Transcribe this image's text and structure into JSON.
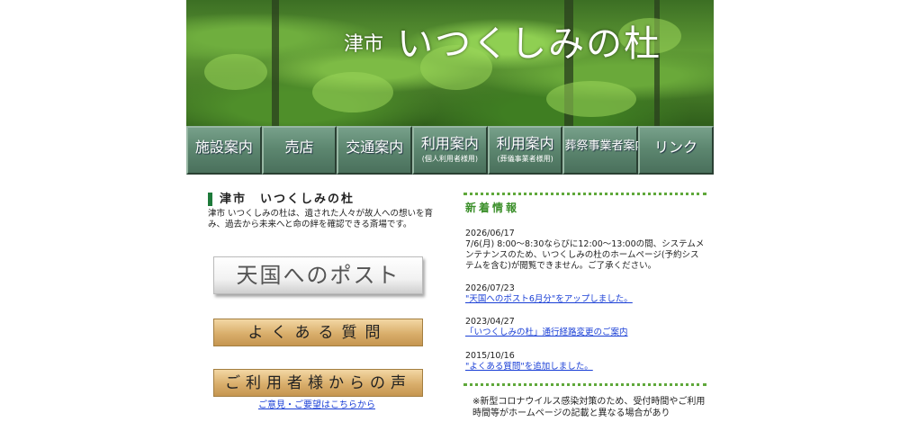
{
  "header": {
    "city": "津市",
    "title": "いつくしみの杜"
  },
  "nav": [
    {
      "label": "施設案内",
      "sub": ""
    },
    {
      "label": "売店",
      "sub": ""
    },
    {
      "label": "交通案内",
      "sub": ""
    },
    {
      "label": "利用案内",
      "sub": "(個人利用者様用)"
    },
    {
      "label": "利用案内",
      "sub": "(葬儀事業者様用)"
    },
    {
      "label": "葬祭事業者案内",
      "sub": ""
    },
    {
      "label": "リンク",
      "sub": ""
    }
  ],
  "intro": {
    "title": "津市　いつくしみの杜",
    "text": "津市 いつくしみの杜は、遺された人々が故人への想いを育み、過去から未来へと命の絆を確認できる斎場です。"
  },
  "buttons": {
    "post": "天国へのポスト",
    "faq": "よくある質問",
    "voice": "ご利用者様からの声",
    "voice_link": "ご意見・ご要望はこちらから"
  },
  "news": {
    "title": "新着情報",
    "items": [
      {
        "date": "2026/06/17",
        "text": "7/6(月) 8:00～8:30ならびに12:00～13:00の間、システムメンテナンスのため、いつくしみの杜のホームページ(予約システムを含む)が閲覧できません。ご了承ください。",
        "link": false
      },
      {
        "date": "2026/07/23",
        "text": "\"天国へのポスト6月分\"をアップしました。",
        "link": true
      },
      {
        "date": "2023/04/27",
        "text": "「いつくしみの杜」通行経路変更のご案内",
        "link": true
      },
      {
        "date": "2015/10/16",
        "text": "\"よくある質問\"を追加しました。",
        "link": true
      }
    ],
    "notice": "※新型コロナウイルス感染対策のため、受付時間やご利用時間等がホームページの記載と異なる場合があり"
  }
}
